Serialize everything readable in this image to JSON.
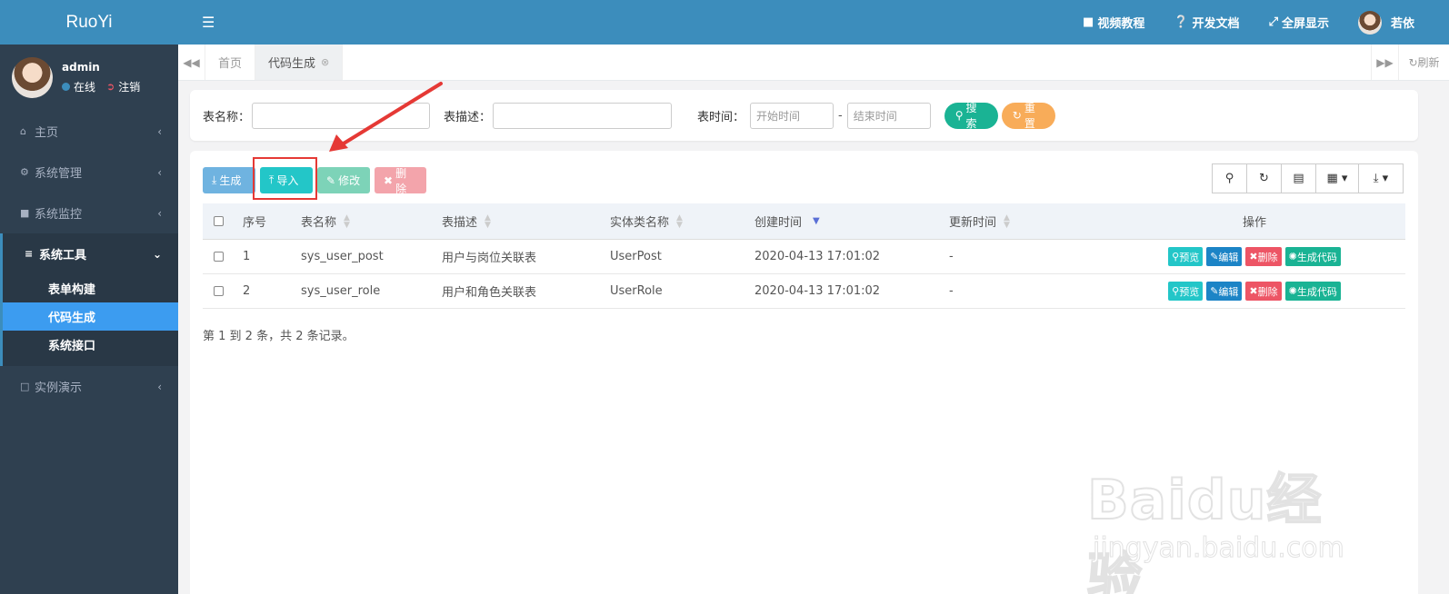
{
  "app": {
    "logo": "RuoYi"
  },
  "user": {
    "name": "admin",
    "status": "在线",
    "logout": "注销",
    "display_name": "若依"
  },
  "sidebar": {
    "items": [
      {
        "icon": "home-icon",
        "label": "主页"
      },
      {
        "icon": "gear-icon",
        "label": "系统管理"
      },
      {
        "icon": "video-icon",
        "label": "系统监控"
      },
      {
        "icon": "bars-icon",
        "label": "系统工具"
      },
      {
        "icon": "desktop-icon",
        "label": "实例演示"
      }
    ],
    "submenu": [
      "表单构建",
      "代码生成",
      "系统接口"
    ],
    "active_sub": "代码生成"
  },
  "header": {
    "video": "视频教程",
    "docs": "开发文档",
    "fullscreen": "全屏显示"
  },
  "tabs": {
    "home": "首页",
    "current": "代码生成",
    "refresh": "刷新"
  },
  "search": {
    "table_name_label": "表名称：",
    "table_desc_label": "表描述：",
    "time_label": "表时间：",
    "start_placeholder": "开始时间",
    "end_placeholder": "结束时间",
    "dash": "-",
    "search_btn": "搜索",
    "reset_btn": "重置"
  },
  "toolbar": {
    "generate": "生成",
    "import": "导入",
    "edit": "修改",
    "delete": "删除"
  },
  "table": {
    "headers": [
      "序号",
      "表名称",
      "表描述",
      "实体类名称",
      "创建时间",
      "更新时间",
      "操作"
    ],
    "rows": [
      {
        "no": "1",
        "name": "sys_user_post",
        "desc": "用户与岗位关联表",
        "entity": "UserPost",
        "created": "2020-04-13 17:01:02",
        "updated": "-"
      },
      {
        "no": "2",
        "name": "sys_user_role",
        "desc": "用户和角色关联表",
        "entity": "UserRole",
        "created": "2020-04-13 17:01:02",
        "updated": "-"
      }
    ],
    "actions": {
      "preview": "预览",
      "edit": "编辑",
      "delete": "删除",
      "gen": "生成代码"
    },
    "summary": "第 1 到 2 条，共 2 条记录。"
  },
  "watermark": {
    "brand": "Baidu经验",
    "url": "jingyan.baidu.com"
  },
  "colors": {
    "primary": "#3c8dbc",
    "sidebar": "#2f4050",
    "teal": "#23b7e5",
    "green": "#1ab394",
    "orange": "#f8ac59",
    "red": "#ed5565",
    "annotation": "#e53935"
  }
}
